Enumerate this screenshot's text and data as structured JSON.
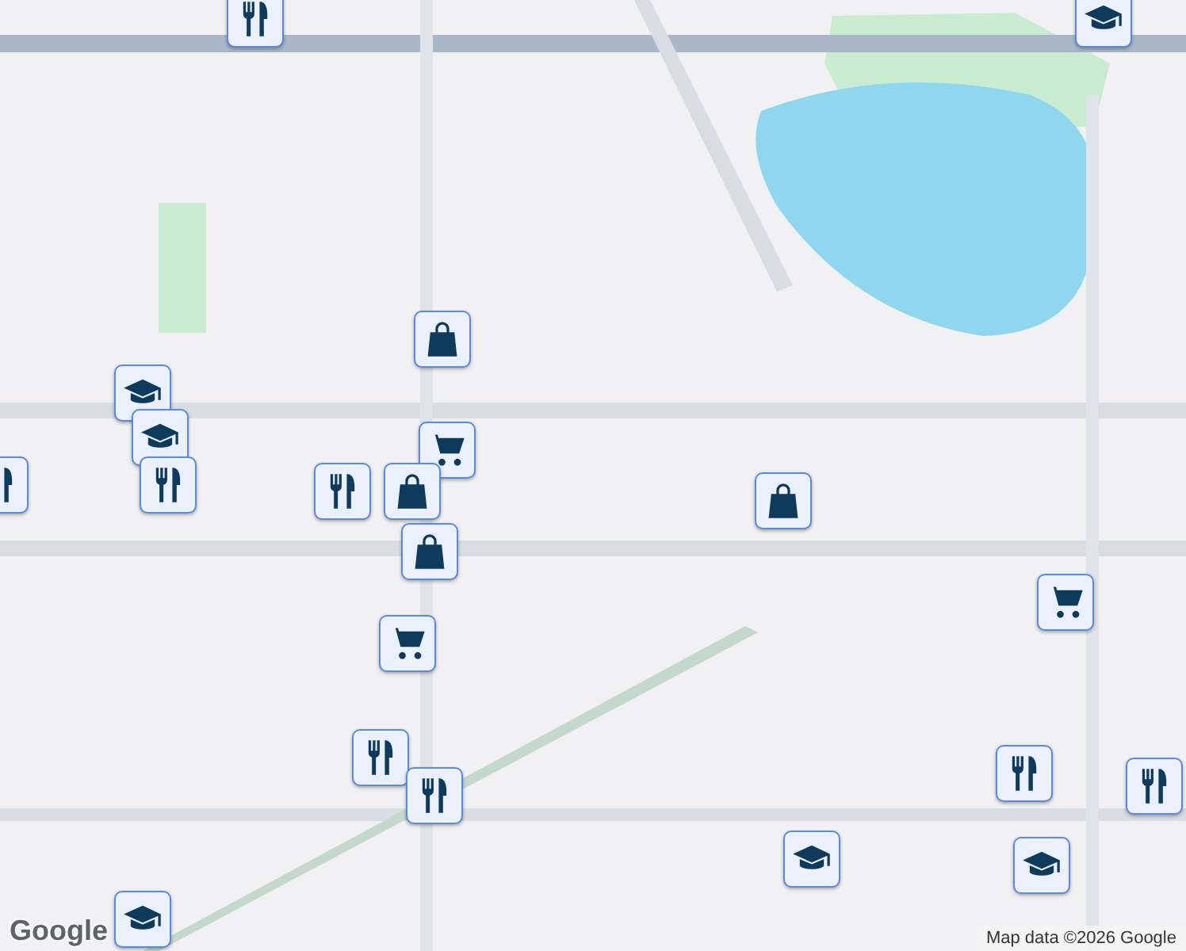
{
  "markers": [
    {
      "kind": "restaurant"
    },
    {
      "kind": "school"
    },
    {
      "kind": "bag"
    },
    {
      "kind": "school"
    },
    {
      "kind": "school"
    },
    {
      "kind": "cart"
    },
    {
      "kind": "restaurant"
    },
    {
      "kind": "restaurant"
    },
    {
      "kind": "restaurant"
    },
    {
      "kind": "bag"
    },
    {
      "kind": "bag"
    },
    {
      "kind": "bag"
    },
    {
      "kind": "cart"
    },
    {
      "kind": "cart"
    },
    {
      "kind": "restaurant"
    },
    {
      "kind": "restaurant"
    },
    {
      "kind": "restaurant"
    },
    {
      "kind": "restaurant"
    },
    {
      "kind": "school"
    },
    {
      "kind": "school"
    },
    {
      "kind": "school"
    }
  ],
  "logo": "Google",
  "attribution": "Map data ©2026 Google"
}
